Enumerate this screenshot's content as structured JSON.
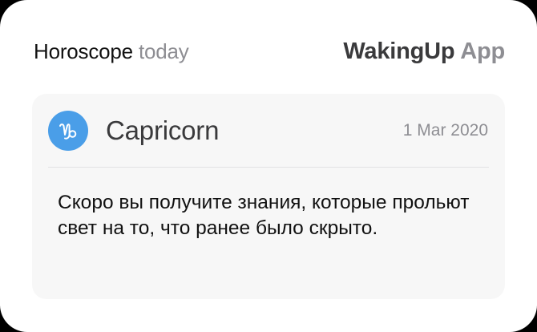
{
  "header": {
    "title_main": "Horoscope",
    "title_suffix": "today",
    "brand_main": "WakingUp",
    "brand_suffix": "App"
  },
  "card": {
    "sign_icon": "capricorn-zodiac-icon",
    "sign_name": "Capricorn",
    "date": "1 Mar 2020",
    "message": "Скоро вы получите знания, которые прольют свет на то, что ранее было скрыто."
  },
  "colors": {
    "icon_background": "#4a9ee8",
    "muted_text": "#8e8e93",
    "card_background": "#f7f7f7"
  }
}
